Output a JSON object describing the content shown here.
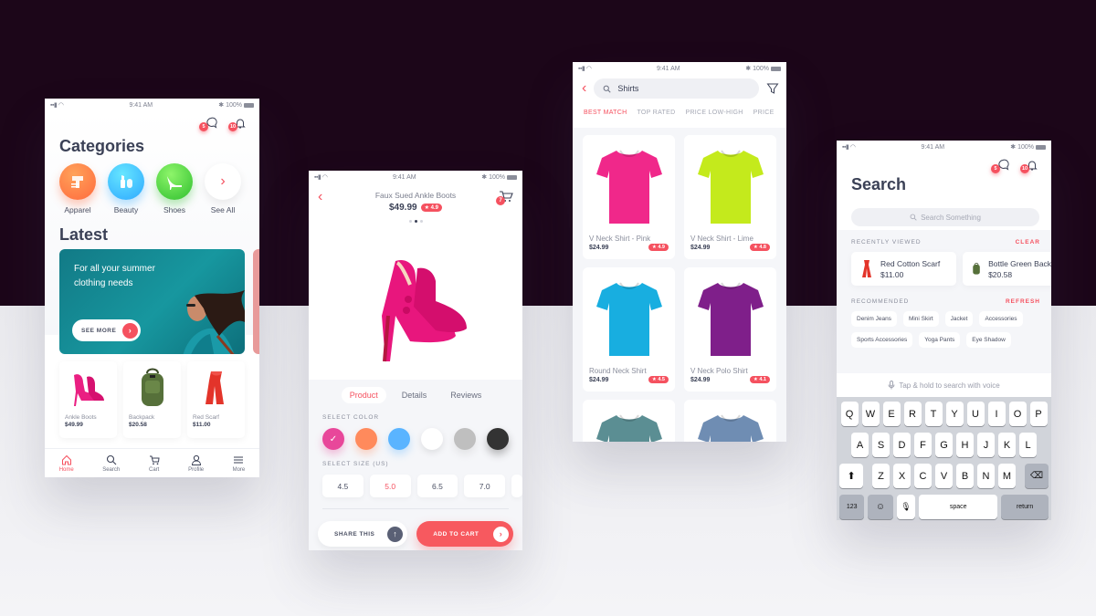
{
  "status_bar": {
    "time": "9:41 AM",
    "battery": "100%"
  },
  "home": {
    "notifications": {
      "messages_count": "5",
      "alerts_count": "10"
    },
    "categories_title": "Categories",
    "categories": [
      {
        "label": "Apparel",
        "icon": "apparel-icon"
      },
      {
        "label": "Beauty",
        "icon": "lipstick-icon"
      },
      {
        "label": "Shoes",
        "icon": "high-heel-icon"
      },
      {
        "label": "See All",
        "icon": "chevron-right-icon"
      }
    ],
    "latest_title": "Latest",
    "banner": {
      "text": "For all your summer clothing needs",
      "cta": "SEE MORE"
    },
    "latest_items": [
      {
        "name": "Ankle Boots",
        "price": "$49.99"
      },
      {
        "name": "Backpack",
        "price": "$20.58"
      },
      {
        "name": "Red Scarf",
        "price": "$11.00"
      }
    ],
    "tabbar": [
      {
        "label": "Home",
        "icon": "home-icon",
        "active": true
      },
      {
        "label": "Search",
        "icon": "search-icon",
        "active": false
      },
      {
        "label": "Cart",
        "icon": "cart-icon",
        "active": false
      },
      {
        "label": "Profile",
        "icon": "profile-icon",
        "active": false
      },
      {
        "label": "More",
        "icon": "menu-icon",
        "active": false
      }
    ]
  },
  "product": {
    "title": "Faux Sued Ankle Boots",
    "price": "$49.99",
    "rating": "★ 4.9",
    "cart_count": "7",
    "image_index": 2,
    "image_count": 3,
    "tabs": [
      "Product",
      "Details",
      "Reviews"
    ],
    "active_tab": "Product",
    "color_label": "SELECT COLOR",
    "colors": [
      "#e8479a",
      "#ff8a5c",
      "#5ab4ff",
      "#ffffff",
      "#bfbfbf",
      "#333333"
    ],
    "selected_color": "#e8479a",
    "size_label": "SELECT SIZE (US)",
    "sizes": [
      "4.5",
      "5.0",
      "6.5",
      "7.0"
    ],
    "selected_size": "5.0",
    "share_label": "SHARE THIS",
    "add_to_cart_label": "ADD TO CART"
  },
  "listing": {
    "search_value": "Shirts",
    "sort_tabs": [
      "BEST MATCH",
      "TOP RATED",
      "PRICE LOW-HIGH",
      "PRICE"
    ],
    "active_sort": "BEST MATCH",
    "products": [
      {
        "name": "V Neck Shirt - Pink",
        "price": "$24.99",
        "rating": "★ 4.9",
        "color": "#f0288a"
      },
      {
        "name": "V Neck Shirt - Lime",
        "price": "$24.99",
        "rating": "★ 4.8",
        "color": "#c4ea1c"
      },
      {
        "name": "Round Neck Shirt",
        "price": "$24.99",
        "rating": "★ 4.5",
        "color": "#18aee0"
      },
      {
        "name": "V Neck Polo Shirt",
        "price": "$24.99",
        "rating": "★ 4.1",
        "color": "#7f1f8a"
      },
      {
        "name": "",
        "price": "",
        "rating": "",
        "color": "#5b8e93"
      },
      {
        "name": "",
        "price": "",
        "rating": "",
        "color": "#6f8db3"
      }
    ]
  },
  "search": {
    "title": "Search",
    "notifications": {
      "messages_count": "5",
      "alerts_count": "10"
    },
    "placeholder": "Search Something",
    "recent_title": "RECENTLY VIEWED",
    "recent_action": "CLEAR",
    "recent": [
      {
        "name": "Red Cotton Scarf",
        "price": "$11.00"
      },
      {
        "name": "Bottle Green Backpack",
        "price": "$20.58"
      }
    ],
    "recommended_title": "RECOMMENDED",
    "recommended_action": "REFRESH",
    "recommended": [
      "Denim Jeans",
      "Mini Skirt",
      "Jacket",
      "Accessories",
      "Sports Accessories",
      "Yoga Pants",
      "Eye Shadow"
    ],
    "voice_hint": "Tap & hold to search with voice",
    "keyboard": {
      "row1": [
        "Q",
        "W",
        "E",
        "R",
        "T",
        "Y",
        "U",
        "I",
        "O",
        "P"
      ],
      "row2": [
        "A",
        "S",
        "D",
        "F",
        "G",
        "H",
        "J",
        "K",
        "L"
      ],
      "row3": [
        "Z",
        "X",
        "C",
        "V",
        "B",
        "N",
        "M"
      ],
      "numbers_label": "123",
      "space_label": "space",
      "return_label": "return"
    }
  }
}
